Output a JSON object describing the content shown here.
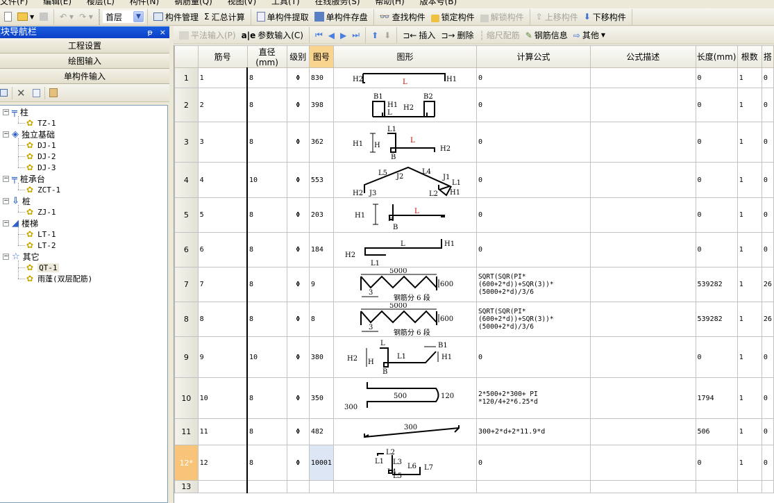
{
  "menu": [
    "文件(F)",
    "编辑(E)",
    "楼层(L)",
    "构件(N)",
    "钢筋量(Q)",
    "视图(V)",
    "工具(T)",
    "在线服务(S)",
    "帮助(H)",
    "版本号(B)"
  ],
  "toolbar": {
    "floor": "首层",
    "component_mgmt": "构件管理",
    "sum_calc": "汇总计算",
    "extract_single": "单构件提取",
    "save_single": "单构件存盘",
    "find": "查找构件",
    "lock": "锁定构件",
    "unlock": "解锁构件",
    "move_up": "上移构件",
    "move_down": "下移构件"
  },
  "panel": {
    "title": "模块导航栏",
    "pin": "ᵽ",
    "close": "×",
    "nav": [
      "工程设置",
      "绘图输入",
      "单构件输入"
    ]
  },
  "tree": [
    {
      "label": "柱",
      "icon": "column-icon",
      "children": [
        "TZ-1"
      ]
    },
    {
      "label": "独立基础",
      "icon": "foundation-icon",
      "children": [
        "DJ-1",
        "DJ-2",
        "DJ-3"
      ]
    },
    {
      "label": "桩承台",
      "icon": "pile-cap-icon",
      "children": [
        "ZCT-1"
      ]
    },
    {
      "label": "桩",
      "icon": "pile-icon",
      "children": [
        "ZJ-1"
      ]
    },
    {
      "label": "楼梯",
      "icon": "stair-icon",
      "children": [
        "LT-1",
        "LT-2"
      ]
    },
    {
      "label": "其它",
      "icon": "star-icon",
      "children": [
        "QT-1",
        "雨蓬(双层配筋)"
      ]
    }
  ],
  "selected_leaf": "QT-1",
  "toolbar2": {
    "flat_input": "平法输入(P)",
    "param_input": "参数输入(C)",
    "insert": "插入",
    "delete": "删除",
    "scale": "缩尺配筋",
    "rebar_info": "钢筋信息",
    "other": "其他"
  },
  "columns": [
    "",
    "筋号",
    "直径(mm)",
    "级别",
    "图号",
    "图形",
    "计算公式",
    "公式描述",
    "长度(mm)",
    "根数",
    "搭"
  ],
  "rows": [
    {
      "idx": "1",
      "bar_no": "1",
      "dia": "8",
      "grade": "Φ",
      "fig": "830",
      "formula": "0",
      "desc": "",
      "length": "0",
      "count": "1",
      "extra": "0"
    },
    {
      "idx": "2",
      "bar_no": "2",
      "dia": "8",
      "grade": "Φ",
      "fig": "398",
      "formula": "0",
      "desc": "",
      "length": "0",
      "count": "1",
      "extra": "0"
    },
    {
      "idx": "3",
      "bar_no": "3",
      "dia": "8",
      "grade": "Φ",
      "fig": "362",
      "formula": "0",
      "desc": "",
      "length": "0",
      "count": "1",
      "extra": "0"
    },
    {
      "idx": "4",
      "bar_no": "4",
      "dia": "10",
      "grade": "Φ",
      "fig": "553",
      "formula": "0",
      "desc": "",
      "length": "0",
      "count": "1",
      "extra": "0"
    },
    {
      "idx": "5",
      "bar_no": "5",
      "dia": "8",
      "grade": "Φ",
      "fig": "203",
      "formula": "0",
      "desc": "",
      "length": "0",
      "count": "1",
      "extra": "0"
    },
    {
      "idx": "6",
      "bar_no": "6",
      "dia": "8",
      "grade": "Φ",
      "fig": "184",
      "formula": "0",
      "desc": "",
      "length": "0",
      "count": "1",
      "extra": "0"
    },
    {
      "idx": "7",
      "bar_no": "7",
      "dia": "8",
      "grade": "Φ",
      "fig": "9",
      "formula": "SQRT(SQR(PI*(600+2*d))+SQR(3))*(5000+2*d)/3/6",
      "desc": "",
      "length": "539282",
      "count": "1",
      "extra": "26"
    },
    {
      "idx": "8",
      "bar_no": "8",
      "dia": "8",
      "grade": "Φ",
      "fig": "8",
      "formula": "SQRT(SQR(PI*(600+2*d))+SQR(3))*(5000+2*d)/3/6",
      "desc": "",
      "length": "539282",
      "count": "1",
      "extra": "26"
    },
    {
      "idx": "9",
      "bar_no": "9",
      "dia": "10",
      "grade": "Φ",
      "fig": "380",
      "formula": "0",
      "desc": "",
      "length": "0",
      "count": "1",
      "extra": "0"
    },
    {
      "idx": "10",
      "bar_no": "10",
      "dia": "8",
      "grade": "Φ",
      "fig": "350",
      "formula": "2*500+2*300+ PI *120/4+2*6.25*d",
      "desc": "",
      "length": "1794",
      "count": "1",
      "extra": "0"
    },
    {
      "idx": "11",
      "bar_no": "11",
      "dia": "8",
      "grade": "Φ",
      "fig": "482",
      "formula": "300+2*d+2*11.9*d",
      "desc": "",
      "length": "506",
      "count": "1",
      "extra": "0"
    },
    {
      "idx": "12*",
      "bar_no": "12",
      "dia": "8",
      "grade": "Φ",
      "fig": "10001",
      "formula": "0",
      "desc": "",
      "length": "0",
      "count": "1",
      "extra": "0"
    },
    {
      "idx": "13",
      "bar_no": "",
      "dia": "",
      "grade": "",
      "fig": "",
      "formula": "",
      "desc": "",
      "length": "",
      "count": "",
      "extra": ""
    }
  ],
  "shape_labels": {
    "r1": [
      "H2",
      "L",
      "H1"
    ],
    "r2": [
      "B1",
      "B2",
      "H1",
      "H2",
      "L"
    ],
    "r3": [
      "H1",
      "H",
      "L1",
      "L",
      "H2",
      "B"
    ],
    "r4": [
      "L5",
      "J2",
      "L4",
      "J1",
      "L1",
      "H2",
      "J3",
      "L2",
      "H1"
    ],
    "r5": [
      "H1",
      "H",
      "L",
      "B"
    ],
    "r6": [
      "L",
      "H1",
      "H2",
      "L1"
    ],
    "r7": [
      "5000",
      "600",
      "3",
      "钢筋分 6 段"
    ],
    "r8": [
      "5000",
      "600",
      "3",
      "钢筋分 6 段"
    ],
    "r9": [
      "L",
      "B1",
      "H2",
      "H",
      "L1",
      "H1",
      "B"
    ],
    "r10": [
      "500",
      "120",
      "300"
    ],
    "r11": [
      "300"
    ],
    "r12": [
      "L2",
      "L1",
      "L3",
      "L6",
      "L7",
      "L4",
      "L5"
    ]
  }
}
